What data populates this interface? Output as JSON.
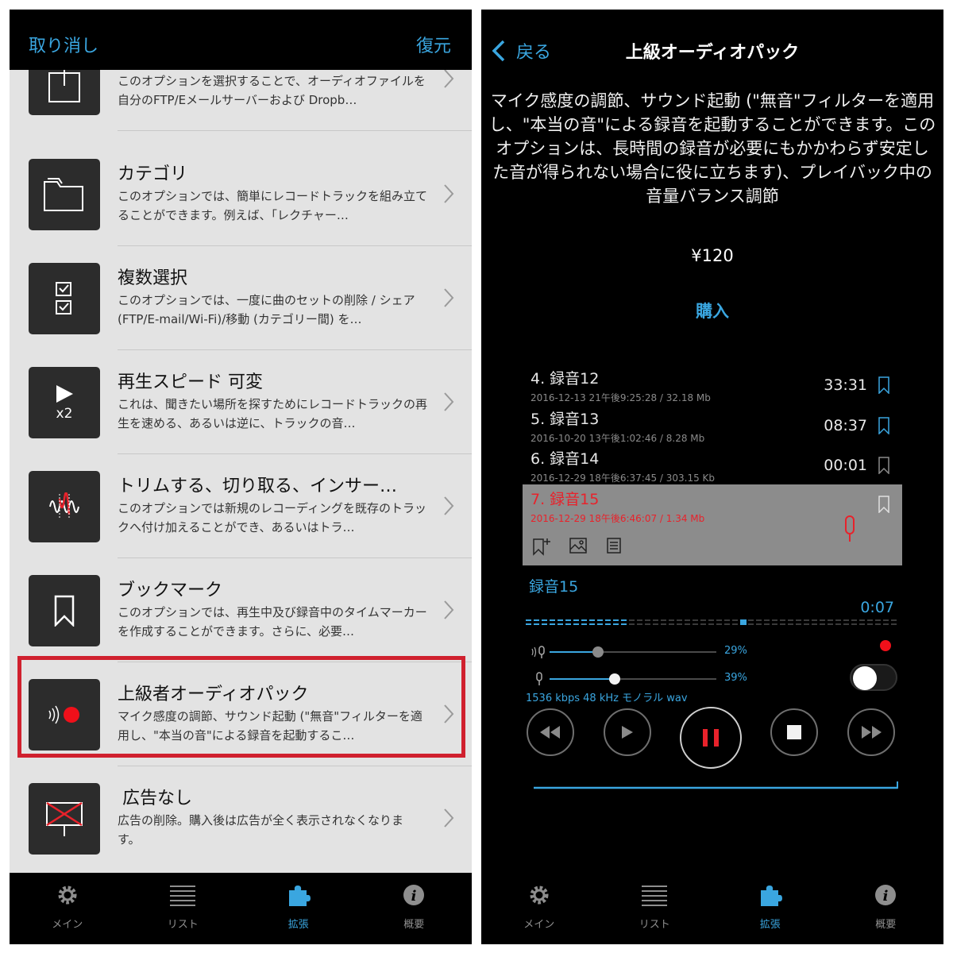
{
  "left": {
    "header": {
      "cancel_label": "取り消し",
      "restore_label": "復元"
    },
    "options": [
      {
        "title": "",
        "desc": "このオプションを選択することで、オーディオファイルを自分のFTP/Eメールサーバーおよび Dropb…",
        "icon": "export-icon"
      },
      {
        "title": "カテゴリ",
        "desc": "このオプションでは、簡単にレコードトラックを組み立てることができます。例えば、「レクチャー…",
        "icon": "folder-icon"
      },
      {
        "title": "複数選択",
        "desc": "このオプションでは、一度に曲のセットの削除 / シェア (FTP/E-mail/Wi-Fi)/移動 (カテゴリー間) を…",
        "icon": "checklist-icon"
      },
      {
        "title": "再生スピード 可変",
        "desc": "これは、聞きたい場所を探すためにレコードトラックの再生を速める、あるいは逆に、トラックの音…",
        "icon": "play-speed-icon",
        "badge": "x2"
      },
      {
        "title": "トリムする、切り取る、インサー…",
        "desc": "このオプションでは新規のレコーディングを既存のトラックへ付け加えることができ、あるいはトラ…",
        "icon": "waveform-trim-icon"
      },
      {
        "title": "ブックマーク",
        "desc": "このオプションでは、再生中及び録音中のタイムマーカーを作成することができます。さらに、必要…",
        "icon": "bookmark-icon"
      },
      {
        "title": "上級者オーディオパック",
        "desc": "マイク感度の調節、サウンド起動 (\"無音\"フィルターを適用し、\"本当の音\"による録音を起動するこ…",
        "icon": "advanced-audio-icon"
      },
      {
        "title": "広告なし",
        "desc": "広告の削除。購入後は広告が全く表示されなくなります。",
        "icon": "no-ads-icon"
      }
    ],
    "tabs": [
      {
        "label": "メイン",
        "icon": "gear-icon"
      },
      {
        "label": "リスト",
        "icon": "list-icon"
      },
      {
        "label": "拡張",
        "icon": "puzzle-icon",
        "active": true
      },
      {
        "label": "概要",
        "icon": "info-icon"
      }
    ]
  },
  "right": {
    "back_label": "戻る",
    "title": "上級オーディオパック",
    "description": "マイク感度の調節、サウンド起動 (\"無音\"フィルターを適用し、\"本当の音\"による録音を起動することができます。このオプションは、長時間の録音が必要にもかかわらず安定した音が得られない場合に役に立ちます)、プレイバック中の音量バランス調節",
    "price": "¥120",
    "buy_label": "購入",
    "recordings": [
      {
        "name": "4. 録音12",
        "meta": "2016-12-13 21午後9:25:28 / 32.18 Mb",
        "duration": "33:31"
      },
      {
        "name": "5. 録音13",
        "meta": "2016-10-20 13午後1:02:46 / 8.28 Mb",
        "duration": "08:37"
      },
      {
        "name": "6. 録音14",
        "meta": "2016-12-29 18午後6:37:45 / 303.15 Kb",
        "duration": "00:01"
      }
    ],
    "active_recording": {
      "name": "7. 録音15",
      "meta": "2016-12-29 18午後6:46:07 / 1.34 Mb"
    },
    "player": {
      "name": "録音15",
      "time": "0:07",
      "progress": 0.27,
      "mic_sensitivity": {
        "percent_label": "29%",
        "value": 0.29
      },
      "volume": {
        "percent_label": "39%",
        "value": 0.39
      },
      "audio_info": "1536 kbps 48 kHz モノラル wav"
    },
    "tabs": [
      {
        "label": "メイン",
        "icon": "gear-icon"
      },
      {
        "label": "リスト",
        "icon": "list-icon"
      },
      {
        "label": "拡張",
        "icon": "puzzle-icon",
        "active": true
      },
      {
        "label": "概要",
        "icon": "info-icon"
      }
    ]
  },
  "colors": {
    "accent": "#3aa6e0",
    "record_red": "#e8222b",
    "highlight_border": "#d0202e"
  }
}
